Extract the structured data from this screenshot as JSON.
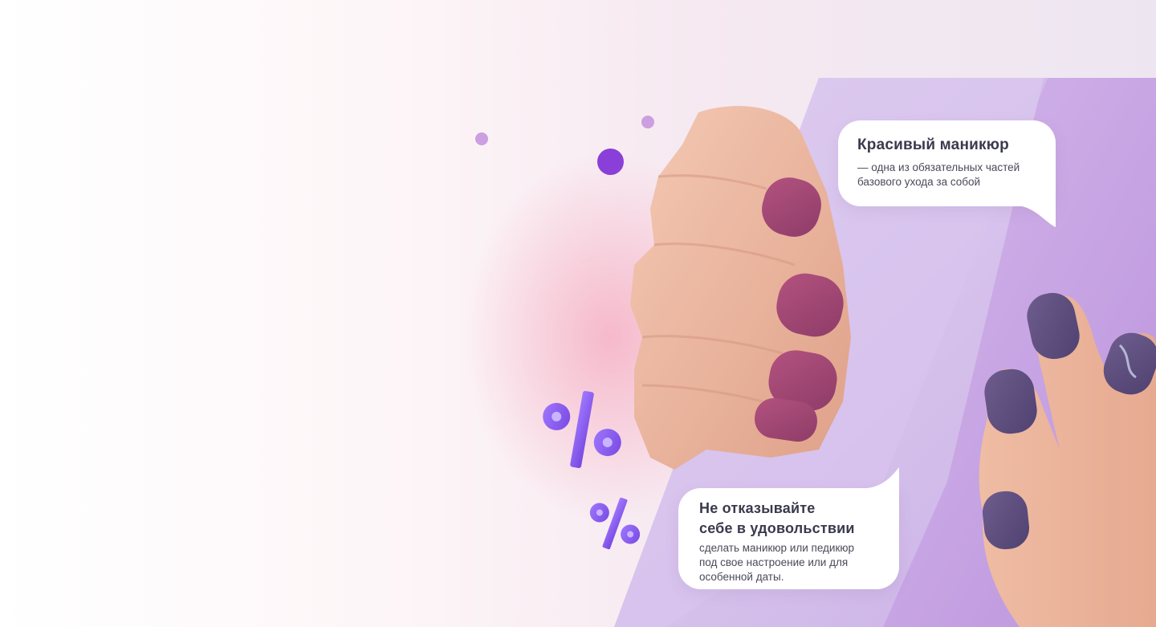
{
  "bubble_top": {
    "title": "Красивый маникюр",
    "line1": "— одна из обязательных частей",
    "line2": "базового ухода за собой"
  },
  "bubble_bottom": {
    "title_line1": "Не отказывайте",
    "title_line2": "себе в удовольствии",
    "line1": "сделать маникюр или педикюр",
    "line2": "под свое настроение или для",
    "line3": "особенной даты."
  },
  "decor": {
    "percent_symbols": [
      "%",
      "%"
    ]
  },
  "colors": {
    "panel_light": "#d9c6ec",
    "panel_mid": "#c7a6e2",
    "accent_dot": "#8a3fd8",
    "small_dot": "#c79ae0",
    "nail_mauve": "#9a3f6f",
    "nail_plum": "#5a4a78",
    "percent": "#8c5af0",
    "text_dark": "#3a3a4d"
  }
}
